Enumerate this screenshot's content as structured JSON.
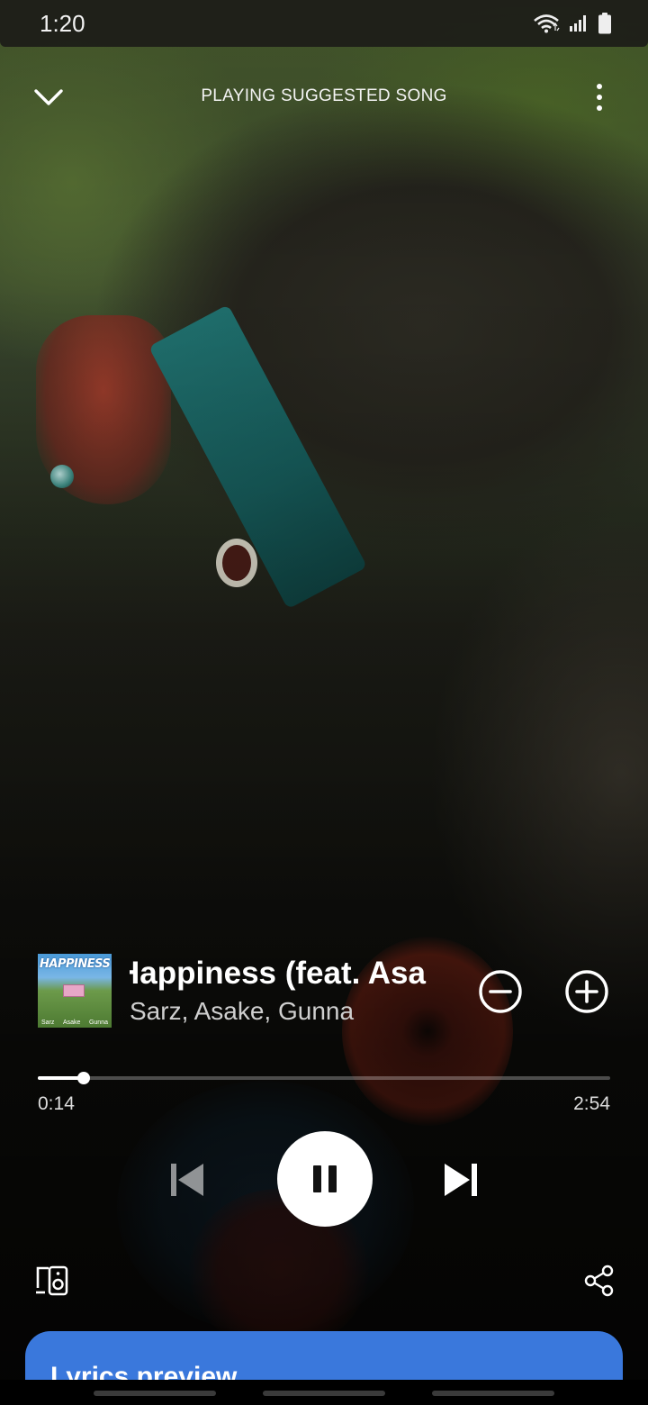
{
  "status_bar": {
    "time": "1:20",
    "icons": [
      "wifi-icon",
      "signal-icon",
      "battery-icon"
    ]
  },
  "header": {
    "title": "PLAYING SUGGESTED SONG",
    "collapse_icon": "chevron-down-icon",
    "more_icon": "more-vertical-icon"
  },
  "track": {
    "cover": {
      "title": "HAPPINESS",
      "credits": [
        "Sarz",
        "Asake",
        "Gunna"
      ]
    },
    "title": "Happiness (feat. Asake & Gunna)",
    "visible_title": "Happiness (feat. Asa",
    "artists": "Sarz, Asake, Gunna",
    "remove_icon": "remove-circle-icon",
    "add_icon": "add-circle-icon"
  },
  "playback": {
    "elapsed": "0:14",
    "total": "2:54",
    "progress_fraction": 0.0805
  },
  "controls": {
    "prev_icon": "skip-previous-icon",
    "pause_icon": "pause-icon",
    "next_icon": "skip-next-icon"
  },
  "footer": {
    "devices_icon": "connect-devices-icon",
    "share_icon": "share-icon"
  },
  "lyrics": {
    "label": "Lyrics preview"
  },
  "colors": {
    "lyrics_card": "#3a78dc",
    "accent": "#ffffff"
  }
}
